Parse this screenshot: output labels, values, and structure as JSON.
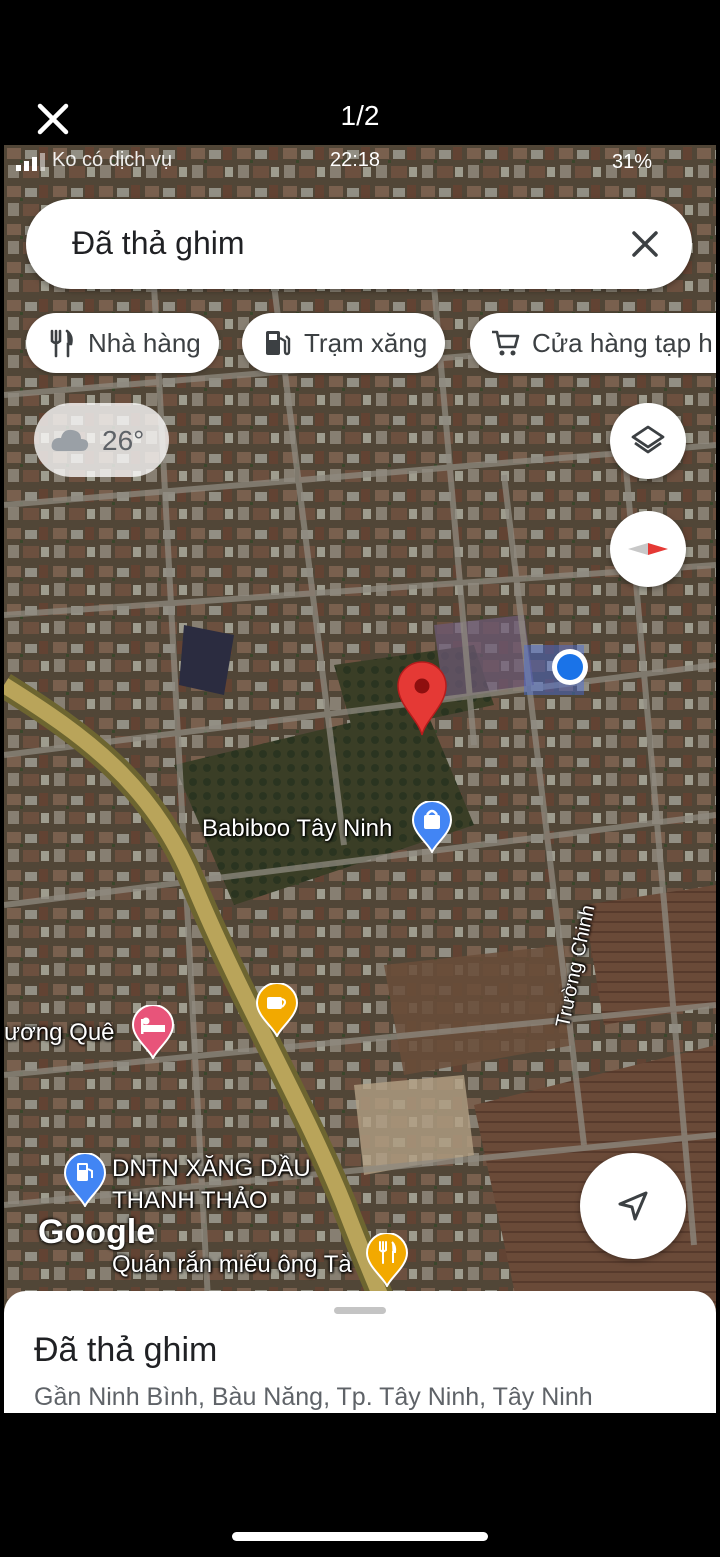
{
  "viewer": {
    "counter": "1/2"
  },
  "status_bar": {
    "carrier": "Ko có dịch vụ",
    "time": "22:18",
    "battery": "31%"
  },
  "search": {
    "text": "Đã thả ghim"
  },
  "chips": [
    {
      "label": "Nhà hàng",
      "icon": "restaurant-icon"
    },
    {
      "label": "Trạm xăng",
      "icon": "gas-station-icon"
    },
    {
      "label": "Cửa hàng tạp h",
      "icon": "cart-icon"
    }
  ],
  "weather": {
    "label": "26°",
    "icon": "cloud-icon"
  },
  "map": {
    "labels": {
      "babiboo": "Babiboo Tây Ninh",
      "huong_que": "ương Quê",
      "truong_chinh": "Trường Chinh",
      "gas_station_line1": "DNTN XĂNG DẦU",
      "gas_station_line2": "THANH THẢO",
      "quan_ran": "Quán rắn miếu ông Tà"
    },
    "google_logo": "Google"
  },
  "place_sheet": {
    "title": "Đã thả ghim",
    "subtitle": "Gần Ninh Bình, Bàu Năng, Tp. Tây Ninh, Tây Ninh"
  },
  "colors": {
    "pin": "#e53935",
    "user_location": "#1a73e8",
    "road": "#b9a45a",
    "shopping_poi": "#4285f4",
    "hotel_poi": "#e8547a",
    "cafe_poi": "#f2a900"
  }
}
